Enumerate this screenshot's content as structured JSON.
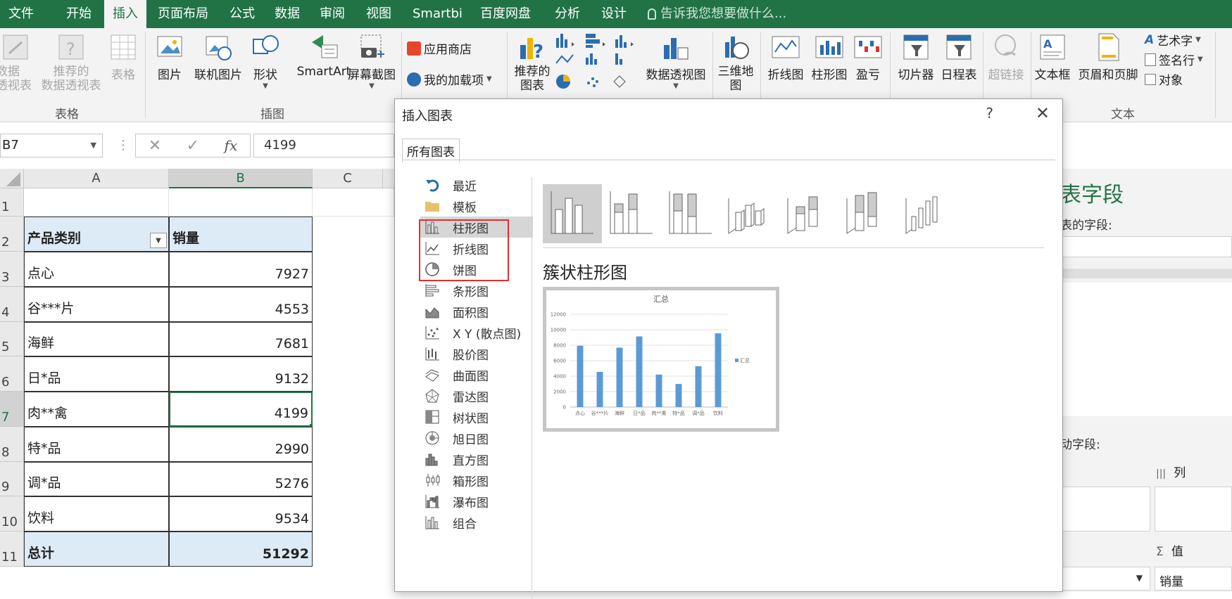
{
  "ribbon_tabs": [
    {
      "label": "文件"
    },
    {
      "label": "开始"
    },
    {
      "label": "插入"
    },
    {
      "label": "页面布局"
    },
    {
      "label": "公式"
    },
    {
      "label": "数据"
    },
    {
      "label": "审阅"
    },
    {
      "label": "视图"
    },
    {
      "label": "Smartbi"
    },
    {
      "label": "百度网盘"
    },
    {
      "label": "分析"
    },
    {
      "label": "设计"
    }
  ],
  "tell_me": "告诉我您想要做什么...",
  "ribbon": {
    "pivot_table": "数据\n透视表",
    "recommended_pivot": "推荐的\n数据透视表",
    "table": "表格",
    "group_tables": "表格",
    "picture": "图片",
    "online_picture": "联机图片",
    "shapes": "形状",
    "smartart": "SmartArt",
    "screenshot": "屏幕截图",
    "group_illustrations": "插图",
    "app_store": "应用商店",
    "my_addins": "我的加载项",
    "recommended_charts": "推荐的\n图表",
    "pivot_chart": "数据透视图",
    "map_3d": "三维地\n图",
    "line": "折线图",
    "column": "柱形图",
    "winloss": "盈亏",
    "slicer": "切片器",
    "timeline": "日程表",
    "hyperlink": "超链接",
    "textbox": "文本框",
    "header_footer": "页眉和页脚",
    "wordart": "艺术字",
    "signature": "签名行",
    "object": "对象",
    "group_text": "文本"
  },
  "formula_bar": {
    "name_box": "B7",
    "fx": "fx",
    "formula": "4199"
  },
  "grid": {
    "columns": [
      "A",
      "B",
      "C"
    ],
    "rows": [
      "1",
      "2",
      "3",
      "4",
      "5",
      "6",
      "7",
      "8",
      "9",
      "10",
      "11"
    ],
    "header": {
      "a": "产品类别",
      "b": "销量"
    },
    "data": [
      {
        "a": "点心",
        "b": "7927"
      },
      {
        "a": "谷***片",
        "b": "4553"
      },
      {
        "a": "海鲜",
        "b": "7681"
      },
      {
        "a": "日*品",
        "b": "9132"
      },
      {
        "a": "肉**禽",
        "b": "4199"
      },
      {
        "a": "特*品",
        "b": "2990"
      },
      {
        "a": "调*品",
        "b": "5276"
      },
      {
        "a": "饮料",
        "b": "9534"
      }
    ],
    "total": {
      "a": "总计",
      "b": "51292"
    }
  },
  "pivot_pane": {
    "title": "表字段",
    "subtitle": "表的字段:",
    "drag": "动字段:",
    "columns": "列",
    "values": "值",
    "value_item": "销量"
  },
  "dialog": {
    "title": "插入图表",
    "help": "?",
    "tab": "所有图表",
    "types": [
      {
        "label": "最近"
      },
      {
        "label": "模板"
      },
      {
        "label": "柱形图"
      },
      {
        "label": "折线图"
      },
      {
        "label": "饼图"
      },
      {
        "label": "条形图"
      },
      {
        "label": "面积图"
      },
      {
        "label": "X Y (散点图)"
      },
      {
        "label": "股价图"
      },
      {
        "label": "曲面图"
      },
      {
        "label": "雷达图"
      },
      {
        "label": "树状图"
      },
      {
        "label": "旭日图"
      },
      {
        "label": "直方图"
      },
      {
        "label": "箱形图"
      },
      {
        "label": "瀑布图"
      },
      {
        "label": "组合"
      }
    ],
    "selected_subtitle": "簇状柱形图"
  },
  "chart_data": {
    "type": "bar",
    "title": "汇总",
    "categories": [
      "点心",
      "谷***片",
      "海鲜",
      "日*品",
      "肉**禽",
      "特*品",
      "调*品",
      "饮料"
    ],
    "series": [
      {
        "name": "汇总",
        "values": [
          7927,
          4553,
          7681,
          9132,
          4199,
          2990,
          5276,
          9534
        ]
      }
    ],
    "yticks": [
      "0",
      "2000",
      "4000",
      "6000",
      "8000",
      "10000",
      "12000"
    ],
    "ylim": [
      0,
      12000
    ],
    "legend": "right",
    "bar_color": "#5b9bd5"
  }
}
